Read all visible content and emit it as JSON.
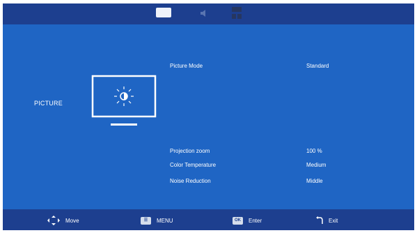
{
  "section": {
    "title": "PICTURE"
  },
  "settings": [
    {
      "label": "Picture Mode",
      "value": "Standard"
    },
    {
      "label": "Projection zoom",
      "value": "100 %"
    },
    {
      "label": "Color Temperature",
      "value": "Medium"
    },
    {
      "label": "Noise Reduction",
      "value": "Middle"
    }
  ],
  "footer": {
    "move_label": "Move",
    "menu_label": "MENU",
    "enter_key": "OK",
    "enter_label": "Enter",
    "exit_label": "Exit"
  },
  "colors": {
    "menu_background": "#1f65c4",
    "bar_background": "#1d3f8f",
    "text": "#ffffff"
  },
  "icons": [
    "picture-tab-icon",
    "sound-tab-icon",
    "setup-tab-icon",
    "tv-brightness-icon",
    "move-arrows-icon",
    "menu-key-icon",
    "ok-key-icon",
    "return-icon"
  ]
}
